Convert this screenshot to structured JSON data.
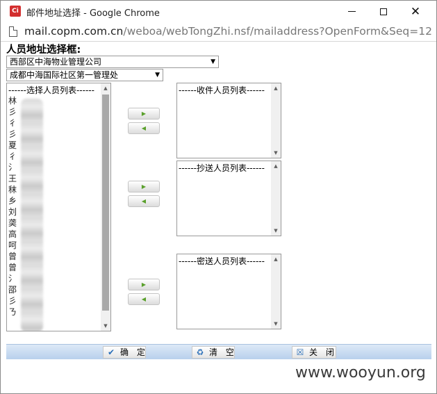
{
  "window": {
    "title": "邮件地址选择 - Google Chrome",
    "app_icon_text": "Ci",
    "controls": {
      "minimize": "—",
      "maximize": "☐",
      "close": "✕"
    }
  },
  "address": {
    "host": "mail.copm.com.cn",
    "path": "/weboa/webTongZhi.nsf/mailaddress?OpenForm&Seq=12"
  },
  "page": {
    "heading": "人员地址选择框:",
    "dept_select": "西部区中海物业管理公司",
    "sub_select": "成都中海国际社区第一管理处",
    "available_header": "------选择人员列表------",
    "available_visible_chars": [
      "林",
      "彡",
      "彳",
      "彡",
      "夏",
      "彳",
      "氵",
      "王",
      "秣",
      "乡",
      "刘",
      "䶮",
      "高",
      "呵",
      "曾",
      "曾",
      "氵",
      "邵",
      "彡",
      "ㄋ"
    ],
    "recipients": [
      {
        "header": "------收件人员列表------"
      },
      {
        "header": "------抄送人员列表------"
      },
      {
        "header": "------密送人员列表------"
      }
    ],
    "add_arrow": "▶",
    "remove_arrow": "◀"
  },
  "toolbar": {
    "ok": "确 定",
    "clear": "清 空",
    "close": "关 闭"
  },
  "watermark": "www.wooyun.org",
  "colors": {
    "toolbar_bg": "#c9dcf2",
    "arrow_green": "#5aa02c",
    "chrome_red": "#d32f2f"
  }
}
